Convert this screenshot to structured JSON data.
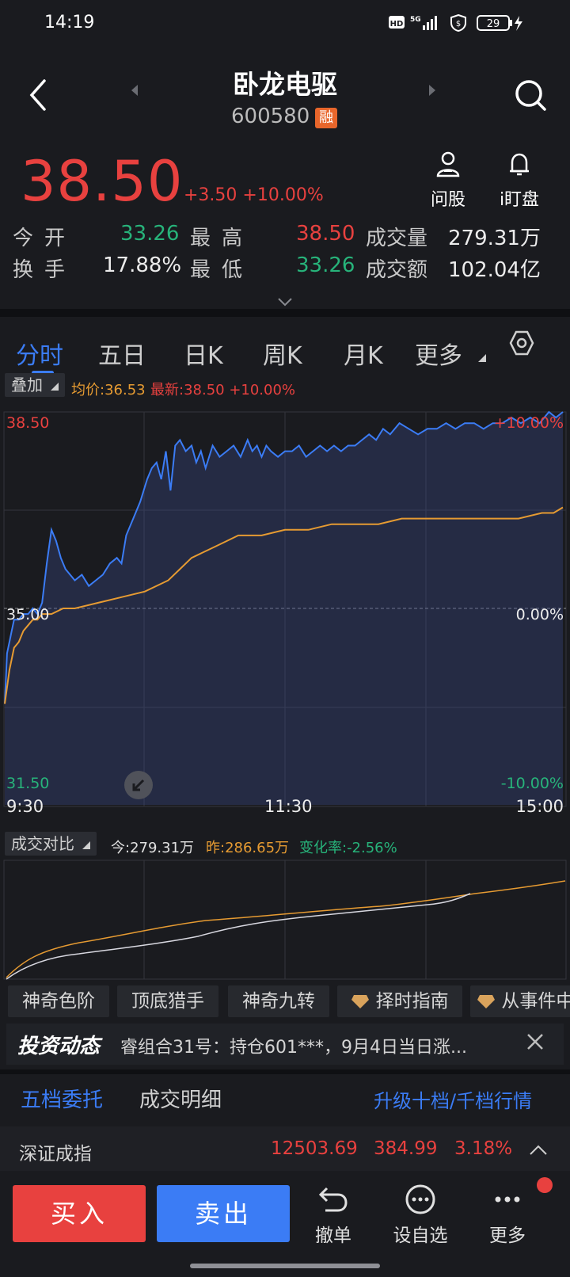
{
  "status_bar": {
    "time": "14:19",
    "network": "5G",
    "battery": "29"
  },
  "header": {
    "stock_name": "卧龙电驱",
    "stock_code": "600580",
    "badge": "融"
  },
  "quote": {
    "price": "38.50",
    "change": "+3.50 +10.00%"
  },
  "actions": {
    "ask_label": "问股",
    "watch_label": "i盯盘"
  },
  "stats": {
    "open_label": "今开",
    "open_value": "33.26",
    "high_label": "最高",
    "high_value": "38.50",
    "volume_label": "成交量",
    "volume_value": "279.31万",
    "turnover_label": "换手",
    "turnover_value": "17.88%",
    "low_label": "最低",
    "low_value": "33.26",
    "amount_label": "成交额",
    "amount_value": "102.04亿"
  },
  "tabs": [
    "分时",
    "五日",
    "日K",
    "周K",
    "月K",
    "更多"
  ],
  "overlay": {
    "button": "叠加",
    "avg_price": "均价:36.53",
    "latest": "最新:38.50 +10.00%"
  },
  "chart_data": {
    "type": "line",
    "price_axis": {
      "top": "38.50",
      "mid": "35.00",
      "bottom": "31.50"
    },
    "pct_axis": {
      "top": "+10.00%",
      "mid": "0.00%",
      "bottom": "-10.00%"
    },
    "ylim": [
      31.5,
      38.5
    ],
    "x_ticks": [
      "9:30",
      "11:30",
      "15:00"
    ],
    "series": [
      {
        "name": "最新",
        "color": "#3b7cf5",
        "x": [
          0,
          2,
          4,
          6,
          8,
          12,
          16,
          20,
          24,
          28,
          32,
          36,
          40,
          44,
          48,
          52,
          56,
          60,
          66,
          72,
          78,
          84,
          90,
          96,
          100,
          104,
          110,
          116,
          122,
          126,
          130,
          134,
          138,
          142,
          146,
          150,
          155,
          160,
          164,
          168,
          172,
          178,
          184,
          190,
          196,
          202,
          208,
          212,
          216,
          220,
          224,
          228,
          234,
          240,
          246,
          252,
          258,
          264,
          270,
          276,
          282,
          288,
          294,
          300,
          306,
          312,
          318,
          324,
          330,
          338,
          346,
          354,
          362,
          370,
          378,
          386,
          394,
          402,
          410,
          418,
          426,
          434,
          442,
          450,
          458,
          466,
          472,
          478
        ],
        "values": [
          33.3,
          34.2,
          34.4,
          34.6,
          34.8,
          34.8,
          34.9,
          34.9,
          35.0,
          34.9,
          35.1,
          35.8,
          36.4,
          36.2,
          35.9,
          35.7,
          35.6,
          35.5,
          35.6,
          35.4,
          35.5,
          35.6,
          35.8,
          35.9,
          35.8,
          36.3,
          36.6,
          36.9,
          37.3,
          37.5,
          37.6,
          37.3,
          37.8,
          37.1,
          37.9,
          38.0,
          37.8,
          37.9,
          37.6,
          37.8,
          37.5,
          37.9,
          37.7,
          37.8,
          37.9,
          37.7,
          38.0,
          37.8,
          37.9,
          37.7,
          37.9,
          37.8,
          37.7,
          37.8,
          37.8,
          37.9,
          37.7,
          37.8,
          37.9,
          37.8,
          37.9,
          37.8,
          37.9,
          37.9,
          38.0,
          38.1,
          38.0,
          38.2,
          38.1,
          38.3,
          38.2,
          38.1,
          38.2,
          38.2,
          38.3,
          38.2,
          38.3,
          38.3,
          38.2,
          38.3,
          38.3,
          38.4,
          38.3,
          38.4,
          38.3,
          38.5,
          38.4,
          38.5
        ]
      },
      {
        "name": "均价",
        "color": "#e69b32",
        "x": [
          0,
          4,
          8,
          12,
          16,
          20,
          24,
          28,
          32,
          40,
          50,
          60,
          80,
          100,
          120,
          140,
          150,
          160,
          170,
          180,
          190,
          200,
          220,
          240,
          260,
          280,
          300,
          320,
          340,
          360,
          380,
          400,
          420,
          440,
          460,
          470,
          478
        ],
        "values": [
          33.3,
          33.9,
          34.3,
          34.4,
          34.6,
          34.7,
          34.8,
          34.8,
          34.9,
          34.9,
          35.0,
          35.0,
          35.1,
          35.2,
          35.3,
          35.5,
          35.7,
          35.9,
          36.0,
          36.1,
          36.2,
          36.3,
          36.3,
          36.4,
          36.4,
          36.5,
          36.5,
          36.5,
          36.6,
          36.6,
          36.6,
          36.6,
          36.6,
          36.6,
          36.7,
          36.7,
          36.8
        ]
      }
    ]
  },
  "volume_compare": {
    "button": "成交对比",
    "today": "今:279.31万",
    "yesterday": "昨:286.65万",
    "change_rate": "变化率:-2.56%"
  },
  "feature_chips": [
    "神奇色阶",
    "顶底猎手",
    "神奇九转",
    "择时指南",
    "从事件中"
  ],
  "news": {
    "title": "投资动态",
    "text": "睿组合31号：持仓601***，9月4日当日涨..."
  },
  "order_book": {
    "tab1": "五档委托",
    "tab2": "成交明细",
    "upgrade": "升级十档/千档行情"
  },
  "index": {
    "name": "深证成指",
    "value": "12503.69",
    "change": "384.99",
    "pct": "3.18%"
  },
  "bottom": {
    "buy": "买入",
    "sell": "卖出",
    "cancel": "撤单",
    "add_watch": "设自选",
    "more": "更多"
  }
}
